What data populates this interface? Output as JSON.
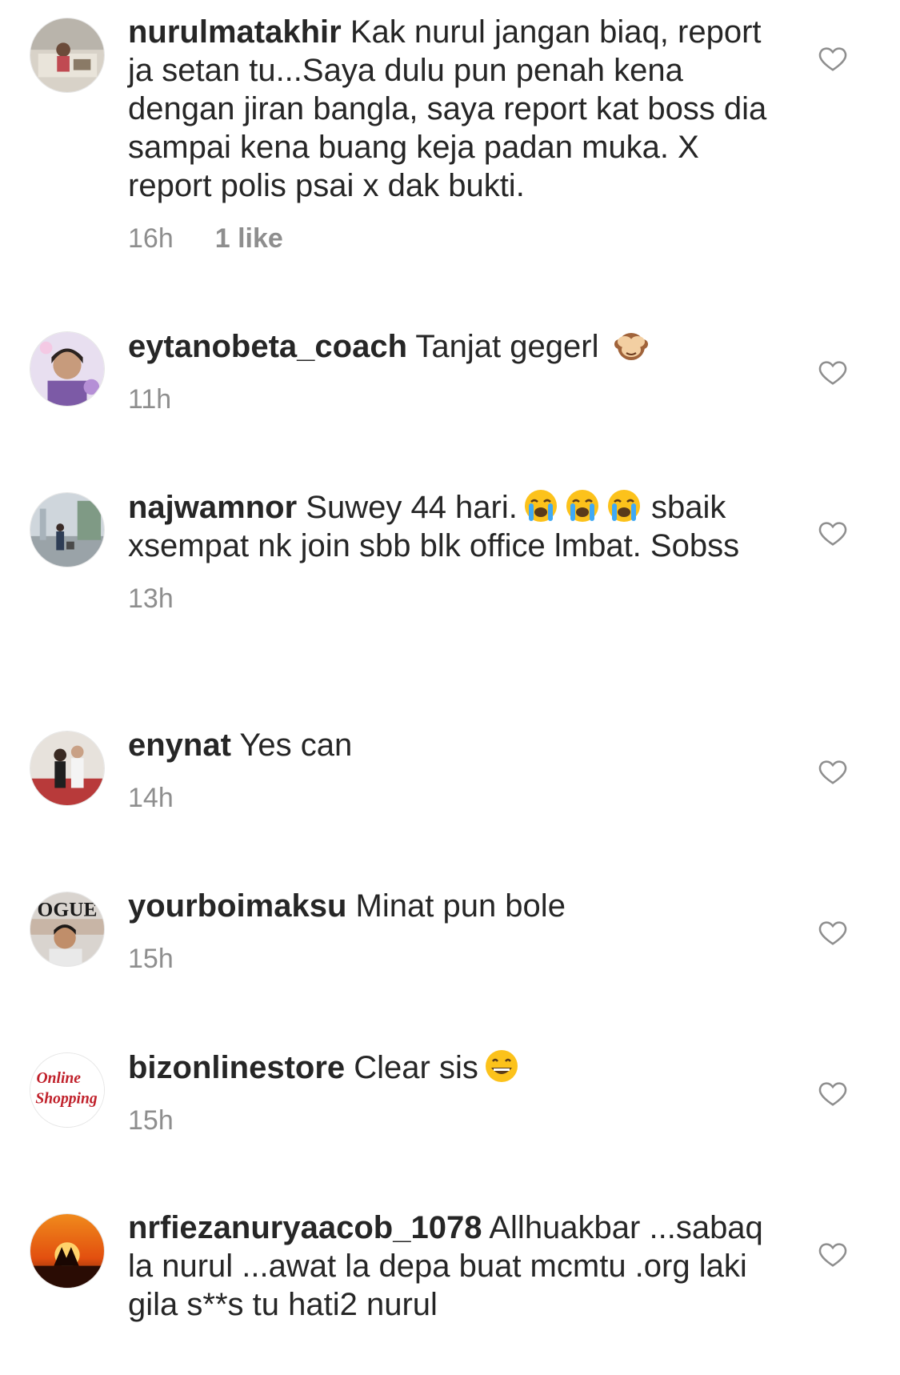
{
  "comments": [
    {
      "username": "nurulmatakhir",
      "text": "Kak nurul jangan biaq, report ja setan tu...Saya dulu pun penah kena dengan jiran bangla, saya report kat boss dia sampai kena buang keja padan muka. X report polis psai x dak bukti.",
      "time": "16h",
      "likes": "1 like",
      "avatar_icon": "photo-avatar-icon"
    },
    {
      "username": "eytanobeta_coach",
      "text": "Tanjat gegerl",
      "emoji": "see-no-evil-monkey-emoji",
      "time": "11h",
      "avatar_icon": "photo-avatar-icon"
    },
    {
      "username": "najwamnor",
      "text": "Suwey 44 hari.",
      "text_after_emoji": "sbaik xsempat nk join sbb blk office lmbat. Sobss",
      "emoji": "loudly-crying-face-emoji",
      "time": "13h",
      "avatar_icon": "photo-avatar-icon"
    },
    {
      "username": "enynat",
      "text": "Yes can",
      "time": "14h",
      "avatar_icon": "photo-avatar-icon"
    },
    {
      "username": "yourboimaksu",
      "text": "Minat pun bole",
      "time": "15h",
      "avatar_icon": "photo-avatar-icon"
    },
    {
      "username": "bizonlinestore",
      "text": "Clear sis",
      "emoji": "grinning-face-emoji",
      "time": "15h",
      "avatar_icon": "online-shopping-logo-icon",
      "avatar_text_1": "Online",
      "avatar_text_2": "Shopping"
    },
    {
      "username": "nrfiezanuryaacob_1078",
      "text": "Allhuakbar ...sabaq la nurul ...awat la depa buat mcmtu .org laki gila s**s tu hati2 nurul",
      "avatar_icon": "sunset-silhouette-avatar-icon"
    }
  ],
  "colors": {
    "text": "#262626",
    "secondary": "#8e8e8e",
    "heart_outline": "#8e8e8e",
    "background": "#ffffff"
  },
  "icons": {
    "like": "heart-outline-icon"
  }
}
